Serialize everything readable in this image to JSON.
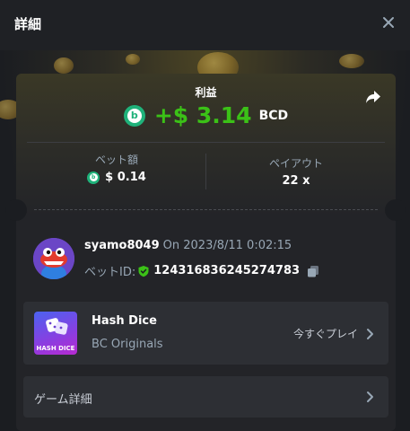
{
  "header": {
    "title": "詳細"
  },
  "profit": {
    "label": "利益",
    "amount": "+$ 3.14",
    "currency": "BCD",
    "coin_glyph": "b",
    "accent_color": "#3bc117"
  },
  "bet_amount": {
    "label": "ベット額",
    "value": "$ 0.14"
  },
  "payout": {
    "label": "ペイアウト",
    "value": "22 x"
  },
  "user": {
    "name": "syamo8049",
    "on_date": "On 2023/8/11 0:02:15",
    "bet_id_label": "ベットID:",
    "bet_id": "124316836245274783"
  },
  "game": {
    "name": "Hash Dice",
    "provider": "BC Originals",
    "thumb_text": "HASH DICE",
    "play_label": "今すぐプレイ"
  },
  "game_details": {
    "label": "ゲーム詳細"
  },
  "icons": {
    "close": "close-icon",
    "share": "share-icon",
    "verified": "shield-check-icon",
    "copy": "copy-icon",
    "chevron": "chevron-right-icon"
  }
}
